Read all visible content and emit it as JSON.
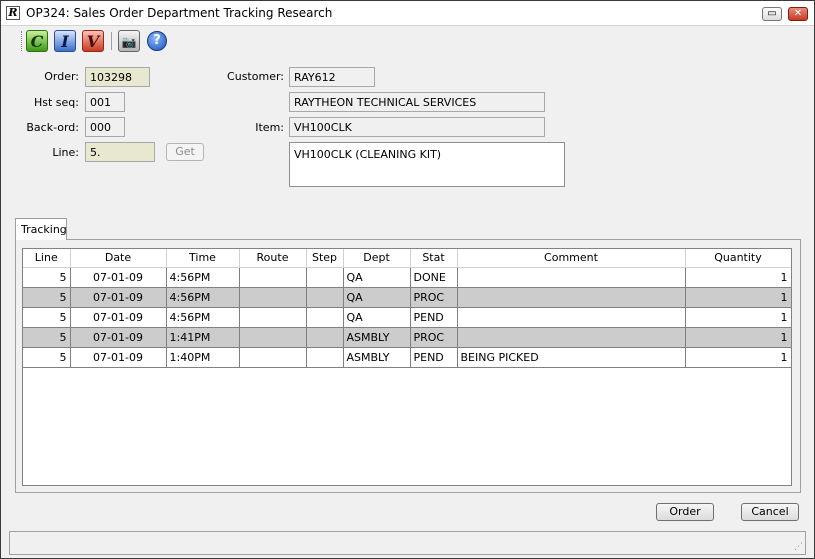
{
  "window": {
    "title": "OP324: Sales Order Department Tracking Research",
    "app_icon_letter": "R",
    "restore_glyph": "▭",
    "close_glyph": "✕"
  },
  "toolbar": {
    "tools": [
      {
        "icon": "c-icon",
        "glyph": "C"
      },
      {
        "icon": "i-icon",
        "glyph": "I"
      },
      {
        "icon": "v-icon",
        "glyph": "V"
      },
      {
        "icon": "camera-icon",
        "glyph": "📷"
      },
      {
        "icon": "help-icon",
        "glyph": "?"
      }
    ]
  },
  "form": {
    "order_label": "Order:",
    "order_value": "103298",
    "hst_seq_label": "Hst seq:",
    "hst_seq_value": "001",
    "back_ord_label": "Back-ord:",
    "back_ord_value": "000",
    "line_label": "Line:",
    "line_value": "5.",
    "get_label": "Get",
    "customer_label": "Customer:",
    "customer_value": "RAY612",
    "customer_name": "RAYTHEON TECHNICAL SERVICES",
    "item_label": "Item:",
    "item_value": "VH100CLK",
    "item_description": "VH100CLK (CLEANING KIT)"
  },
  "tabs": [
    {
      "label": "Tracking"
    }
  ],
  "tracking": {
    "columns": [
      "Line",
      "Date",
      "Time",
      "Route",
      "Step",
      "Dept",
      "Stat",
      "Comment",
      "Quantity"
    ],
    "rows": [
      {
        "line": "5",
        "date": "07-01-09",
        "time": "4:56PM",
        "route": "",
        "step": "",
        "dept": "QA",
        "stat": "DONE",
        "comment": "",
        "quantity": "1"
      },
      {
        "line": "5",
        "date": "07-01-09",
        "time": "4:56PM",
        "route": "",
        "step": "",
        "dept": "QA",
        "stat": "PROC",
        "comment": "",
        "quantity": "1"
      },
      {
        "line": "5",
        "date": "07-01-09",
        "time": "4:56PM",
        "route": "",
        "step": "",
        "dept": "QA",
        "stat": "PEND",
        "comment": "",
        "quantity": "1"
      },
      {
        "line": "5",
        "date": "07-01-09",
        "time": "1:41PM",
        "route": "",
        "step": "",
        "dept": "ASMBLY",
        "stat": "PROC",
        "comment": "",
        "quantity": "1"
      },
      {
        "line": "5",
        "date": "07-01-09",
        "time": "1:40PM",
        "route": "",
        "step": "",
        "dept": "ASMBLY",
        "stat": "PEND",
        "comment": "BEING PICKED",
        "quantity": "1"
      }
    ]
  },
  "footer": {
    "order_button": "Order",
    "cancel_button": "Cancel"
  }
}
